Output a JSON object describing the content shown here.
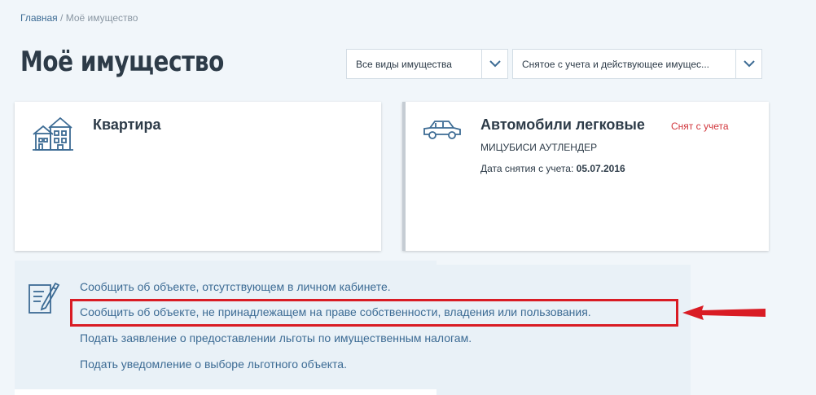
{
  "breadcrumb": {
    "home": "Главная",
    "separator": " / ",
    "current": "Моё имущество"
  },
  "page_title": "Моё имущество",
  "filters": {
    "kind": {
      "selected": "Все виды имущества",
      "icon": "chevron-down-icon"
    },
    "status": {
      "selected": "Снятое с учета и действующее имущес...",
      "icon": "chevron-down-icon"
    }
  },
  "cards": {
    "flat": {
      "title": "Квартира",
      "icon": "house-icon"
    },
    "car": {
      "title": "Автомобили легковые",
      "status": "Снят с учета",
      "model": "МИЦУБИСИ АУТЛЕНДЕР",
      "date_label": "Дата снятия с учета: ",
      "date_value": "05.07.2016",
      "icon": "car-icon"
    }
  },
  "actions": {
    "icon": "pencil-note-icon",
    "items": [
      "Сообщить об объекте, отсутствующем в личном кабинете.",
      "Сообщить об объекте, не принадлежащем на праве собственности, владения или пользования.",
      "Подать заявление о предоставлении льготы по имущественным налогам.",
      "Подать уведомление о выборе льготного объекта."
    ]
  },
  "colors": {
    "link": "#3c6b94",
    "accent_red": "#d91c24",
    "status_red": "#d1363c",
    "background": "#f1f6fa"
  }
}
